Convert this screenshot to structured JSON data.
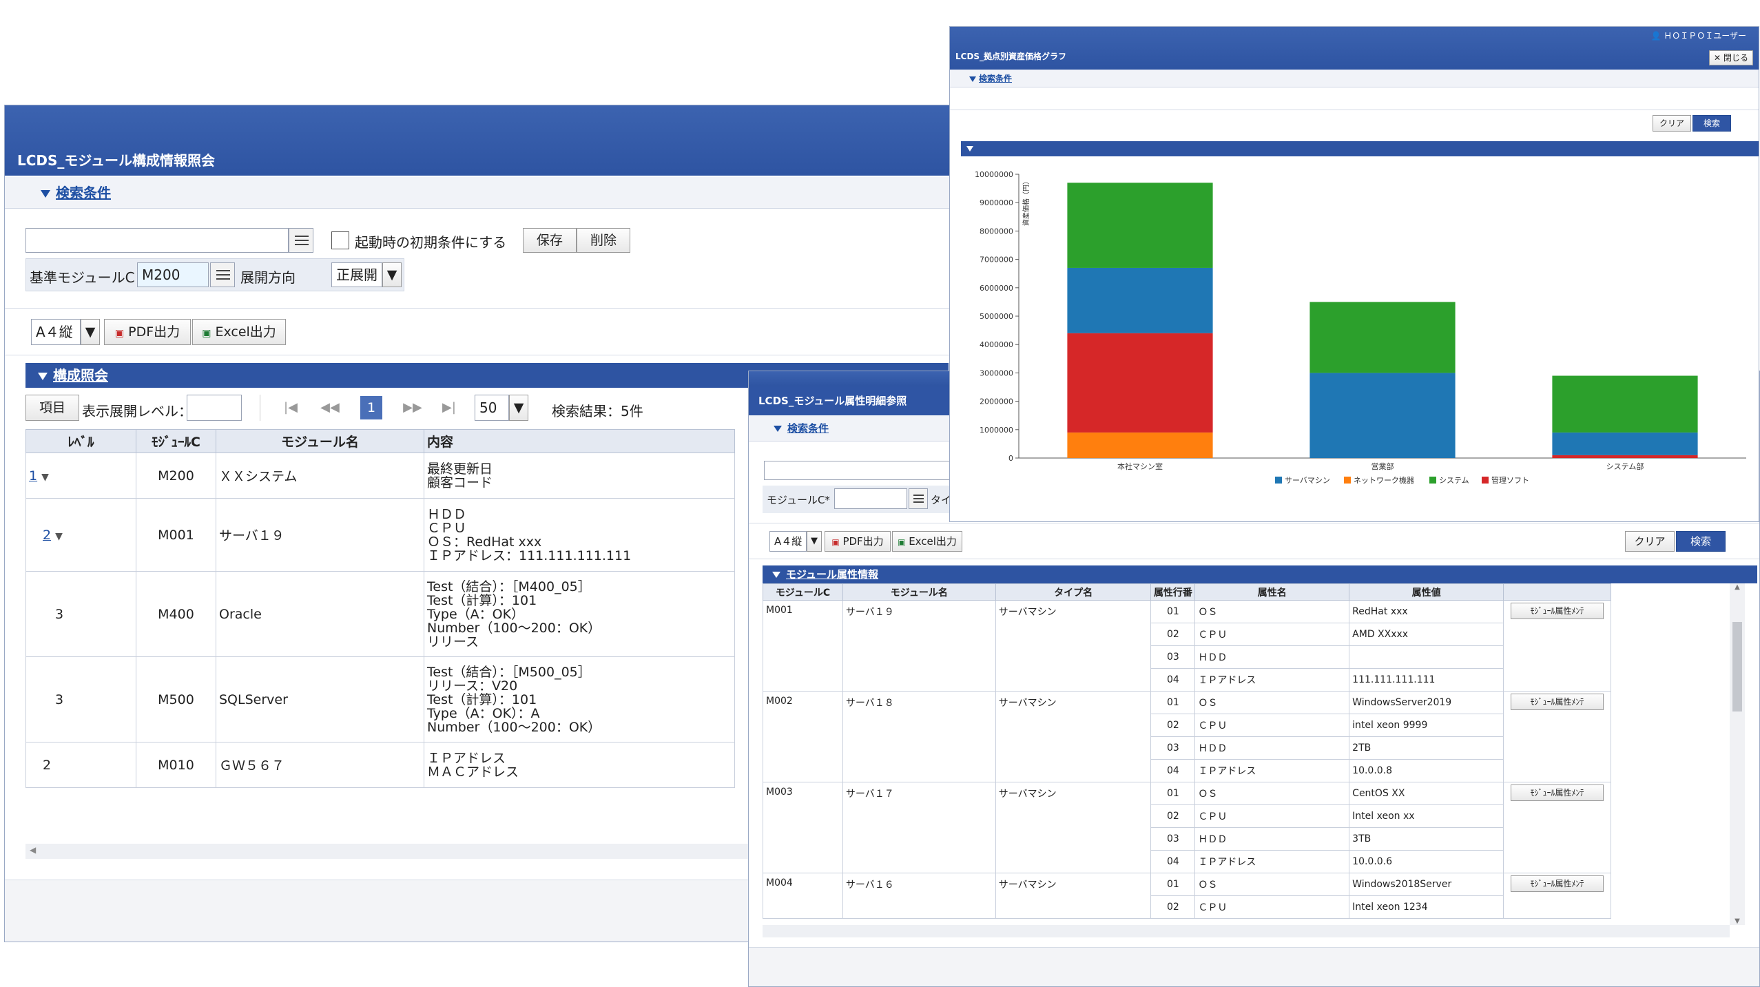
{
  "main": {
    "title": "LCDS_モジュール構成情報照会",
    "search_section": "検索条件",
    "startup_checkbox": "起動時の初期条件にする",
    "save_btn": "保存",
    "delete_btn": "削除",
    "base_module_label": "基準モジュールC",
    "base_module_value": "M200",
    "direction_label": "展開方向",
    "direction_value": "正展開",
    "paper_select": "A４縦",
    "pdf_btn": "PDF出力",
    "excel_btn": "Excel出力",
    "result_section": "構成照会",
    "item_btn": "項目",
    "level_label": "表示展開レベル：",
    "current_page": "1",
    "per_page": "50",
    "result_count": "検索結果：5件",
    "columns": [
      "ﾚﾍﾞﾙ",
      "ﾓｼﾞｭｰﾙC",
      "モジュール名",
      "内容"
    ],
    "rows": [
      {
        "level": "1",
        "code": "M200",
        "name": "ＸＸシステム",
        "content": [
          "最終更新日",
          "顧客コード"
        ]
      },
      {
        "level": "2",
        "code": "M001",
        "name": "サーバ１９",
        "content": [
          "ＨＤＤ",
          "ＣＰＵ",
          "ＯＳ：RedHat xxx",
          "ＩＰアドレス：111.111.111.111"
        ]
      },
      {
        "level": "3",
        "code": "M400",
        "name": "Oracle",
        "content": [
          "Test（結合）：［M400_05］",
          "Test（計算）：101",
          "Type（A：OK）",
          "Number（100～200：OK）",
          "リリース"
        ]
      },
      {
        "level": "3",
        "code": "M500",
        "name": "SQLServer",
        "content": [
          "Test（結合）：［M500_05］",
          "リリース：V20",
          "Test（計算）：101",
          "Type（A：OK）：A",
          "Number（100～200：OK）"
        ]
      },
      {
        "level": "2",
        "code": "M010",
        "name": "ＧＷ５６７",
        "content": [
          "ＩＰアドレス",
          "ＭＡＣアドレス"
        ]
      }
    ]
  },
  "attr": {
    "title": "LCDS_モジュール属性明細参照",
    "search_section": "検索条件",
    "module_label": "モジュールC*",
    "type_label": "タイ",
    "paper_select": "A４縦",
    "pdf_btn": "PDF出力",
    "excel_btn": "Excel出力",
    "clear_btn": "クリア",
    "search_btn": "検索",
    "section": "モジュール属性情報",
    "columns": [
      "モジュールC",
      "モジュール名",
      "タイプ名",
      "属性行番",
      "属性名",
      "属性値"
    ],
    "maint_btn": "ﾓｼﾞｭｰﾙ属性ﾒﾝﾃ",
    "groups": [
      {
        "code": "M001",
        "name": "サーバ１９",
        "type": "サーバマシン",
        "attrs": [
          [
            "01",
            "ＯＳ",
            "RedHat xxx"
          ],
          [
            "02",
            "ＣＰＵ",
            "AMD XXxxx"
          ],
          [
            "03",
            "ＨＤＤ",
            ""
          ],
          [
            "04",
            "ＩＰアドレス",
            "111.111.111.111"
          ]
        ]
      },
      {
        "code": "M002",
        "name": "サーバ１８",
        "type": "サーバマシン",
        "attrs": [
          [
            "01",
            "ＯＳ",
            "WindowsServer2019"
          ],
          [
            "02",
            "ＣＰＵ",
            "intel xeon 9999"
          ],
          [
            "03",
            "ＨＤＤ",
            "2TB"
          ],
          [
            "04",
            "ＩＰアドレス",
            "10.0.0.8"
          ]
        ]
      },
      {
        "code": "M003",
        "name": "サーバ１７",
        "type": "サーバマシン",
        "attrs": [
          [
            "01",
            "ＯＳ",
            "CentOS XX"
          ],
          [
            "02",
            "ＣＰＵ",
            "Intel xeon xx"
          ],
          [
            "03",
            "ＨＤＤ",
            "3TB"
          ],
          [
            "04",
            "ＩＰアドレス",
            "10.0.0.6"
          ]
        ]
      },
      {
        "code": "M004",
        "name": "サーバ１６",
        "type": "サーバマシン",
        "attrs": [
          [
            "01",
            "ＯＳ",
            "Windows2018Server"
          ],
          [
            "02",
            "ＣＰＵ",
            "Intel xeon 1234"
          ]
        ]
      }
    ]
  },
  "graph": {
    "user": "ＨＯＩＰＯＩユーザー",
    "title": "LCDS_拠点別資産価格グラフ",
    "close_btn": "閉じる",
    "search_section": "検索条件",
    "clear_btn": "クリア",
    "search_btn": "検索"
  },
  "chart_data": {
    "type": "bar",
    "stacked": true,
    "title": "",
    "ylabel": "資産価格（円）",
    "ylim": [
      0,
      10000000
    ],
    "yticks": [
      "0",
      "1000000",
      "2000000",
      "3000000",
      "4000000",
      "5000000",
      "6000000",
      "7000000",
      "8000000",
      "9000000",
      "10000000"
    ],
    "categories": [
      "本社マシン室",
      "営業部",
      "システム部"
    ],
    "series": [
      {
        "name": "サーバマシン",
        "color": "#1f77b4",
        "values": [
          2300000,
          3000000,
          800000
        ]
      },
      {
        "name": "ネットワーク機器",
        "color": "#ff7f0e",
        "values": [
          900000,
          0,
          0
        ]
      },
      {
        "name": "システム",
        "color": "#2ca02c",
        "values": [
          3000000,
          2500000,
          2000000
        ]
      },
      {
        "name": "管理ソフト",
        "color": "#d62728",
        "values": [
          3500000,
          0,
          100000
        ]
      }
    ],
    "legend_position": "bottom"
  }
}
